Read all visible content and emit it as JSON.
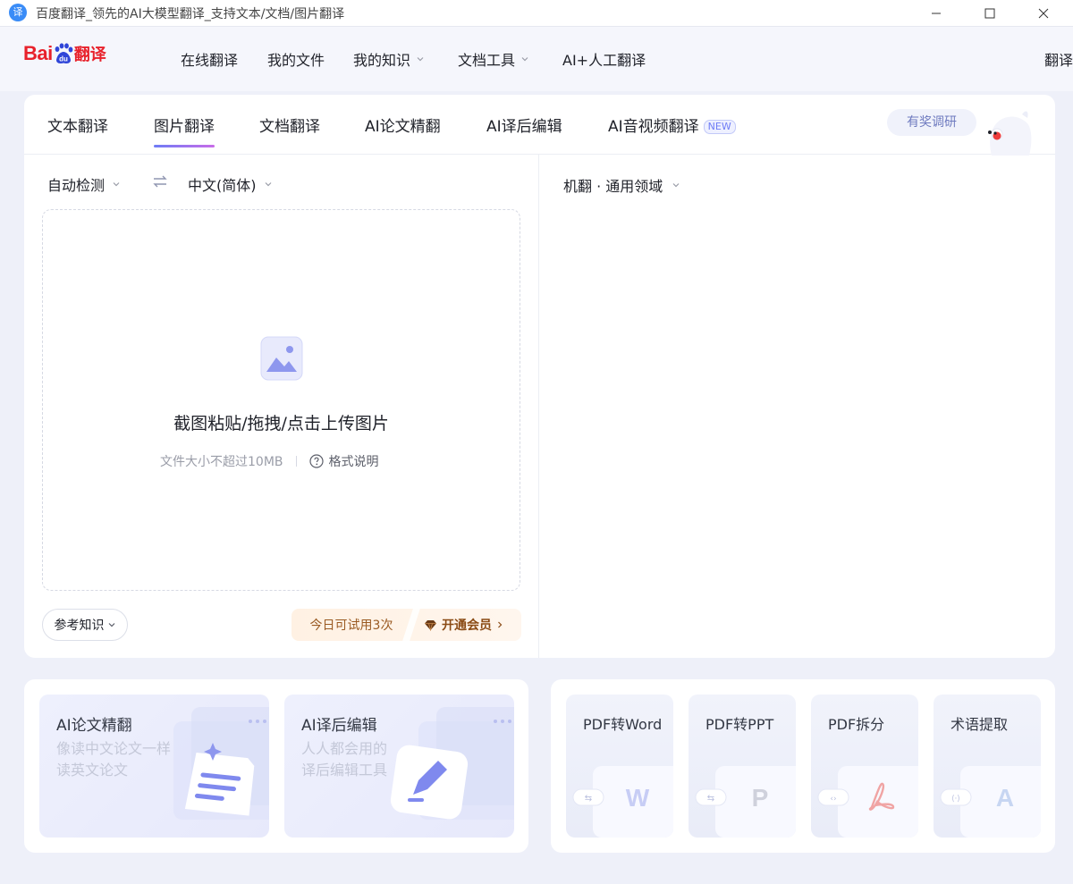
{
  "window": {
    "app_icon": "译",
    "title": "百度翻译_领先的AI大模型翻译_支持文本/文档/图片翻译"
  },
  "topnav": {
    "logo": {
      "bai": "Bai",
      "du": "du",
      "fanyi": "翻译"
    },
    "items": [
      "在线翻译",
      "我的文件",
      "我的知识",
      "文档工具",
      "AI+人工翻译",
      "翻译"
    ]
  },
  "tabs": {
    "items": [
      "文本翻译",
      "图片翻译",
      "文档翻译",
      "AI论文精翻",
      "AI译后编辑",
      "AI音视频翻译"
    ],
    "active": "图片翻译",
    "new_badge": "NEW",
    "survey": "有奖调研"
  },
  "source": {
    "from_lang": "自动检测",
    "to_lang": "中文(简体)"
  },
  "dropzone": {
    "title": "截图粘贴/拖拽/点击上传图片",
    "size_limit": "文件大小不超过10MB",
    "format_help": "格式说明"
  },
  "footer": {
    "reference": "参考知识",
    "trial": "今日可试用3次",
    "vip": "开通会员"
  },
  "target": {
    "engine": "机翻 · 通用领域"
  },
  "promos": [
    {
      "title": "AI论文精翻",
      "desc": [
        "像读中文论文一样",
        "读英文论文"
      ]
    },
    {
      "title": "AI译后编辑",
      "desc": [
        "人人都会用的",
        "译后编辑工具"
      ]
    }
  ],
  "tools": [
    {
      "title": "PDF转Word",
      "icon": "W"
    },
    {
      "title": "PDF转PPT",
      "icon": "P"
    },
    {
      "title": "PDF拆分",
      "icon": "pdf-acrobat"
    },
    {
      "title": "术语提取",
      "icon": "A"
    }
  ],
  "colors": {
    "brand_red": "#e8212b",
    "accent": "#6e7cf6",
    "page_bg": "#eef0f9"
  }
}
